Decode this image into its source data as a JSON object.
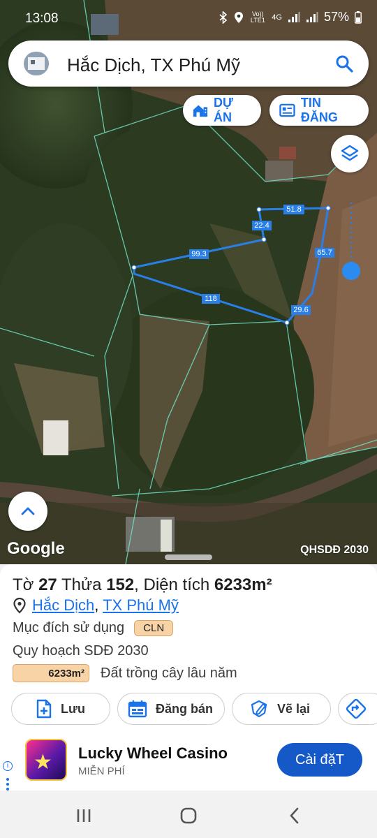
{
  "status_bar": {
    "time": "13:08",
    "signal_text": "Vo)) LTE1",
    "network": "4G",
    "battery": "57%"
  },
  "search": {
    "title": "Hắc Dịch, TX Phú Mỹ"
  },
  "map_buttons": {
    "project_label": "DỰ ÁN",
    "listing_label": "TIN ĐĂNG"
  },
  "map": {
    "attribution": "Google",
    "layer_label": "QHSDĐ 2030",
    "boundary_color": "#2a7fe6",
    "edge_lengths": [
      "51.8",
      "22.4",
      "99.3",
      "65.7",
      "118",
      "29.6"
    ]
  },
  "parcel": {
    "sheet_prefix": "Tờ",
    "sheet_no": "27",
    "lot_prefix": "Thửa",
    "lot_no": "152",
    "area_prefix": ", Diện tích",
    "area": "6233m²",
    "address_commune": "Hắc Dịch",
    "address_separator": ",",
    "address_town": "TX Phú Mỹ",
    "purpose_label": "Mục đích sử dụng",
    "purpose_code": "CLN",
    "plan_label": "Quy hoạch SDĐ 2030",
    "plan_area": "6233m²",
    "plan_desc": "Đất trồng cây lâu năm"
  },
  "actions": {
    "save": "Lưu",
    "sell": "Đăng bán",
    "redraw": "Vẽ lại"
  },
  "ad": {
    "title": "Lucky Wheel Casino",
    "subtitle": "MIỄN PHÍ",
    "install": "Cài đặT"
  }
}
